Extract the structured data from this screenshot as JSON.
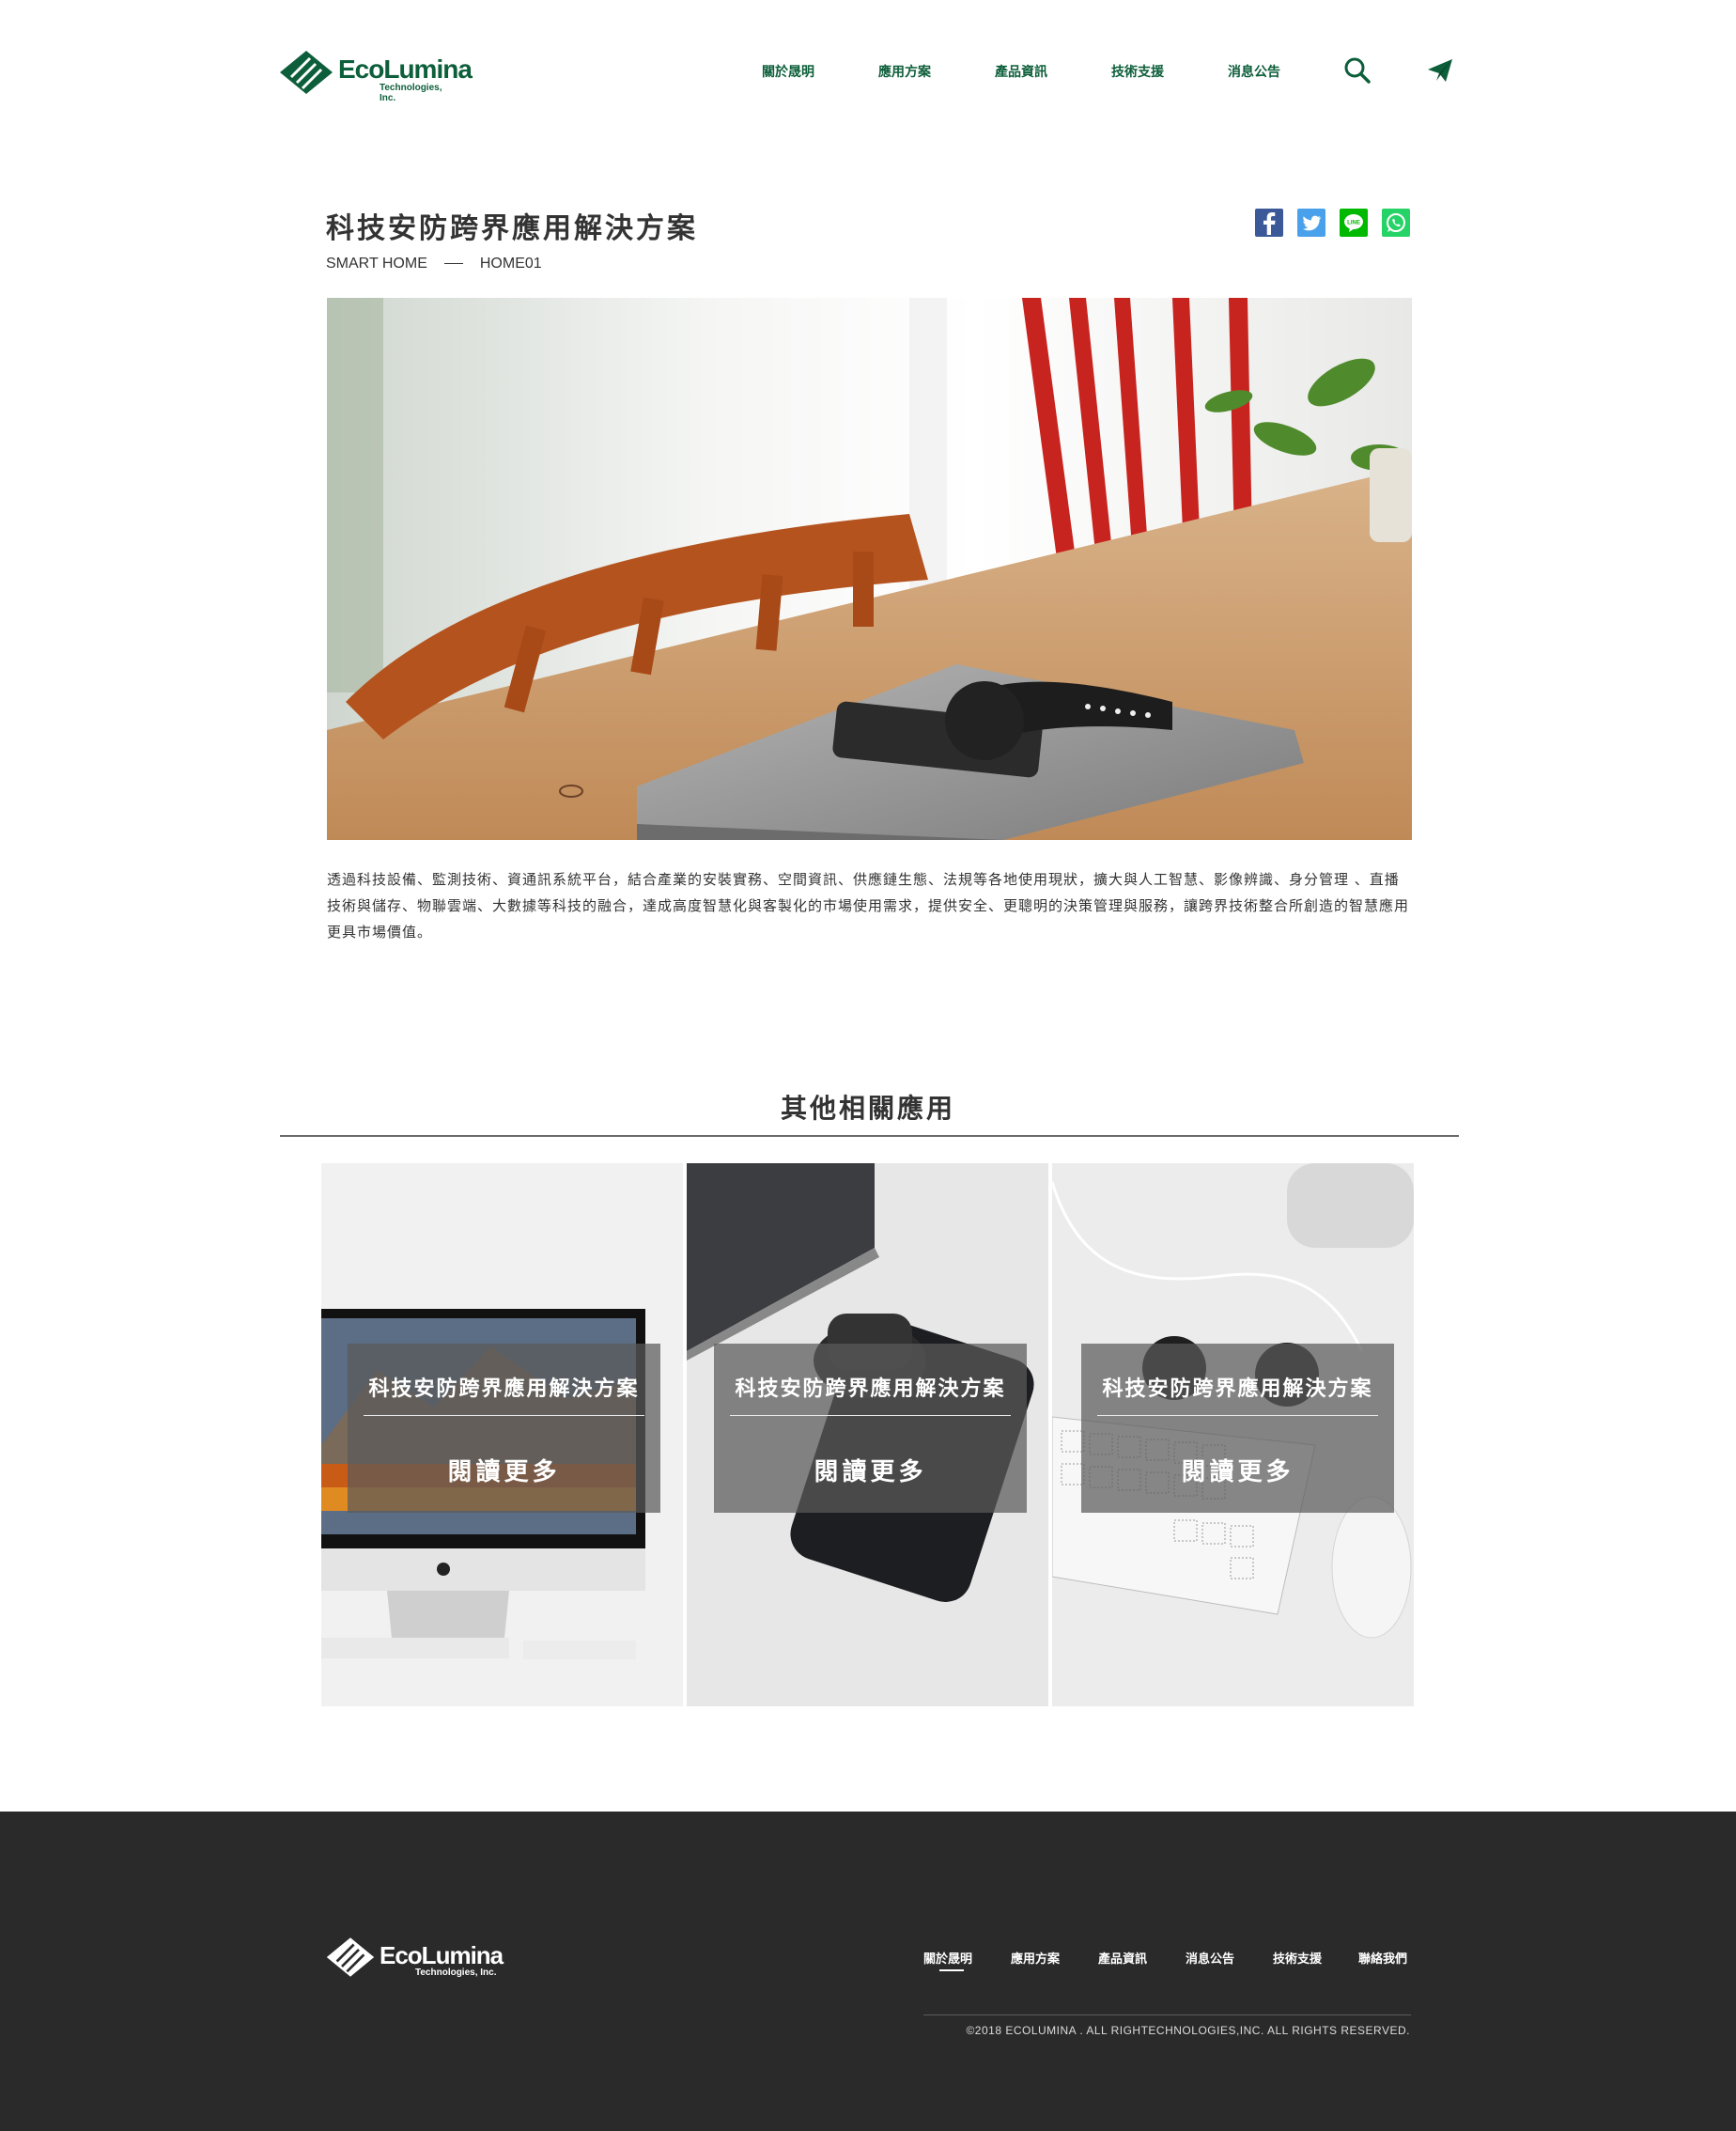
{
  "brand": {
    "name": "EcoLumina",
    "subtitle": "Technologies, Inc.",
    "color": "#0d5e3a"
  },
  "nav": {
    "items": [
      {
        "label": "關於晟明"
      },
      {
        "label": "應用方案"
      },
      {
        "label": "產品資訊"
      },
      {
        "label": "技術支援"
      },
      {
        "label": "消息公告"
      }
    ],
    "icons": [
      "search-icon",
      "paper-plane-icon"
    ]
  },
  "article": {
    "title": "科技安防跨界應用解決方案",
    "breadcrumb": [
      "SMART HOME",
      "HOME01"
    ],
    "share": [
      "facebook-icon",
      "twitter-icon",
      "line-icon",
      "whatsapp-icon"
    ],
    "body": "透過科技設備、監測技術、資通訊系統平台，結合產業的安裝實務、空間資訊、供應鏈生態、法規等各地使用現狀，擴大與人工智慧、影像辨識、身分管理 、直播技術與儲存、物聯雲端、大數據等科技的融合，達成高度智慧化與客製化的市場使用需求，提供安全、更聰明的決策管理與服務，讓跨界技術整合所創造的智慧應用更具市場價值。"
  },
  "related": {
    "title": "其他相關應用",
    "cards": [
      {
        "title": "科技安防跨界應用解決方案",
        "button": "閱讀更多"
      },
      {
        "title": "科技安防跨界應用解決方案",
        "button": "閱讀更多"
      },
      {
        "title": "科技安防跨界應用解決方案",
        "button": "閱讀更多"
      }
    ]
  },
  "footer": {
    "nav": [
      {
        "label": "關於晟明"
      },
      {
        "label": "應用方案"
      },
      {
        "label": "產品資訊"
      },
      {
        "label": "消息公告"
      },
      {
        "label": "技術支援"
      },
      {
        "label": "聯絡我們"
      }
    ],
    "copyright": "©2018 ECOLUMINA . ALL RIGHTECHNOLOGIES,INC. ALL RIGHTS RESERVED."
  }
}
